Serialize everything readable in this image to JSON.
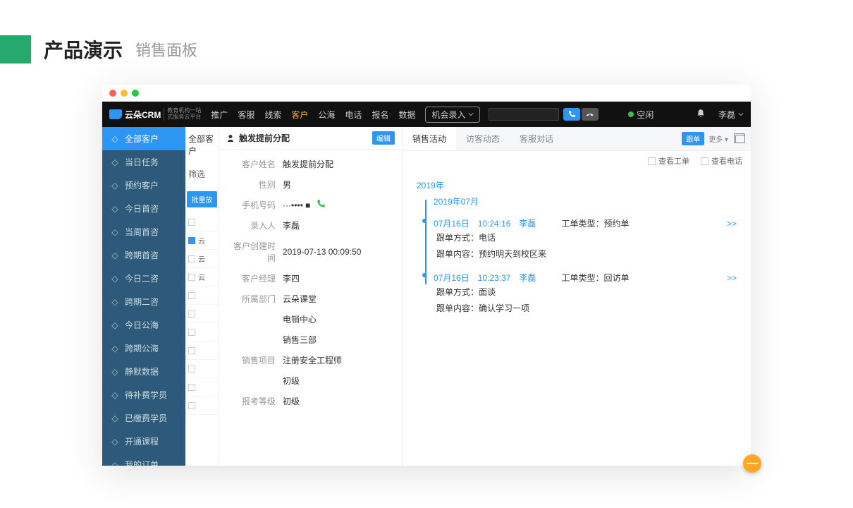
{
  "page": {
    "title": "产品演示",
    "subtitle": "销售面板"
  },
  "logo": {
    "text": "云朵CRM",
    "sub1": "教育机构一站",
    "sub2": "式服务云平台"
  },
  "nav": {
    "items": [
      "推广",
      "客服",
      "线索",
      "客户",
      "公海",
      "电话",
      "报名",
      "数据"
    ],
    "active": 3,
    "pill": "机会录入",
    "status": "空闲",
    "user": "李磊"
  },
  "sidebar": {
    "items": [
      {
        "label": "全部客户",
        "icon": "user"
      },
      {
        "label": "当日任务",
        "icon": "check"
      },
      {
        "label": "预约客户",
        "icon": "user"
      },
      {
        "label": "今日首咨",
        "icon": "chat"
      },
      {
        "label": "当周首咨",
        "icon": "chat"
      },
      {
        "label": "跨期首咨",
        "icon": "chat"
      },
      {
        "label": "今日二咨",
        "icon": "chat"
      },
      {
        "label": "跨期二咨",
        "icon": "chat"
      },
      {
        "label": "今日公海",
        "icon": "sea"
      },
      {
        "label": "跨期公海",
        "icon": "sea"
      },
      {
        "label": "静默数据",
        "icon": "data"
      },
      {
        "label": "待补费学员",
        "icon": "money"
      },
      {
        "label": "已缴费学员",
        "icon": "money"
      },
      {
        "label": "开通课程",
        "icon": "book"
      },
      {
        "label": "我的订单",
        "icon": "order"
      }
    ],
    "active": 0
  },
  "stub": {
    "header": "全部客户",
    "filter": "筛选",
    "batch_btn": "批量放",
    "rows": [
      "",
      "云",
      "云",
      "云",
      "",
      "",
      "",
      "",
      "",
      "",
      ""
    ]
  },
  "detail": {
    "title": "触发提前分配",
    "edit_btn": "编辑",
    "fields": [
      {
        "label": "客户姓名",
        "value": "触发提前分配"
      },
      {
        "label": "性别",
        "value": "男"
      },
      {
        "label": "手机号码",
        "value": "···•••• ■",
        "phone": true
      },
      {
        "label": "录入人",
        "value": "李磊"
      },
      {
        "label": "客户创建时间",
        "value": "2019-07-13 00:09:50"
      },
      {
        "label": "客户经理",
        "value": "李四"
      },
      {
        "label": "所属部门",
        "value": "云朵课堂"
      },
      {
        "label": "",
        "value": "电销中心"
      },
      {
        "label": "",
        "value": "销售三部"
      },
      {
        "label": "销售项目",
        "value": "注册安全工程师"
      },
      {
        "label": "",
        "value": "初级"
      },
      {
        "label": "报考等级",
        "value": "初级"
      }
    ]
  },
  "activity": {
    "tabs": [
      "销售活动",
      "访客动态",
      "客服对话"
    ],
    "active": 0,
    "tag_btn": "跟单",
    "more_btn": "更多 ▾",
    "filters": [
      {
        "label": "查看工单"
      },
      {
        "label": "查看电话"
      }
    ],
    "year": "2019年",
    "month": "2019年07月",
    "entries": [
      {
        "date": "07月16日",
        "time": "10:24:16",
        "who": "李磊",
        "type_label": "工单类型：",
        "type": "预约单",
        "way_label": "跟单方式：",
        "way": "电话",
        "content_label": "跟单内容：",
        "content": "预约明天到校区来",
        "more": ">>"
      },
      {
        "date": "07月16日",
        "time": "10:23:37",
        "who": "李磊",
        "type_label": "工单类型：",
        "type": "回访单",
        "way_label": "跟单方式：",
        "way": "面谈",
        "content_label": "跟单内容：",
        "content": "确认学习一项",
        "more": ">>"
      }
    ]
  },
  "fab": "—"
}
